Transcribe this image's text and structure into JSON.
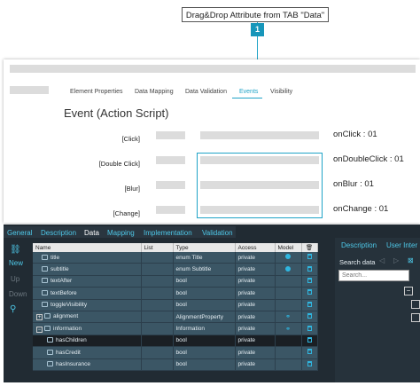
{
  "callout": {
    "text": "Drag&Drop Attribute from TAB \"Data\"",
    "badge": "1"
  },
  "designer": {
    "tabs": [
      "Element Properties",
      "Data Mapping",
      "Data Validation",
      "Events",
      "Visibility"
    ],
    "active_tab": "Events",
    "title": "Event (Action Script)",
    "events": [
      {
        "label": "[Click]",
        "handler": "onClick : 01"
      },
      {
        "label": "[Double Click]",
        "handler": "onDoubleClick : 01"
      },
      {
        "label": "[Blur]",
        "handler": "onBlur : 01"
      },
      {
        "label": "[Change]",
        "handler": "onChange : 01"
      }
    ]
  },
  "bottom": {
    "tabs": [
      "General",
      "Description",
      "Data",
      "Mapping",
      "Implementation",
      "Validation"
    ],
    "active_tab": "Data",
    "side": {
      "new": "New",
      "up": "Up",
      "down": "Down"
    },
    "columns": [
      "Name",
      "List",
      "Type",
      "Access",
      "Model"
    ],
    "rows": [
      {
        "name": "title",
        "type": "enum Title",
        "access": "private",
        "model": "dot",
        "indent": 1
      },
      {
        "name": "subtitle",
        "type": "enum Subtitle",
        "access": "private",
        "model": "dot",
        "indent": 1
      },
      {
        "name": "textAfter",
        "type": "bool",
        "access": "private",
        "model": "",
        "indent": 1
      },
      {
        "name": "textBefore",
        "type": "bool",
        "access": "private",
        "model": "",
        "indent": 1
      },
      {
        "name": "toggleVisibility",
        "type": "bool",
        "access": "private",
        "model": "",
        "indent": 1
      },
      {
        "name": "alignment",
        "type": "AlignmentProperty",
        "access": "private",
        "model": "link",
        "indent": 0,
        "expander": "+"
      },
      {
        "name": "information",
        "type": "Information",
        "access": "private",
        "model": "link",
        "indent": 0,
        "expander": "−"
      },
      {
        "name": "hasChildren",
        "type": "bool",
        "access": "private",
        "model": "",
        "indent": 2,
        "selected": true
      },
      {
        "name": "hasCredit",
        "type": "bool",
        "access": "private",
        "model": "",
        "indent": 2
      },
      {
        "name": "hasInsurance",
        "type": "bool",
        "access": "private",
        "model": "",
        "indent": 2
      }
    ],
    "right_panel": {
      "tabs": [
        "Description",
        "User Inter"
      ],
      "search_label": "Search data",
      "search_placeholder": "Search...",
      "nav": [
        "◁",
        "▷",
        "⊠"
      ]
    }
  },
  "colors": {
    "accent": "#1fa3c7",
    "dark_bg": "#212b33",
    "row_bg": "#3b5665"
  }
}
